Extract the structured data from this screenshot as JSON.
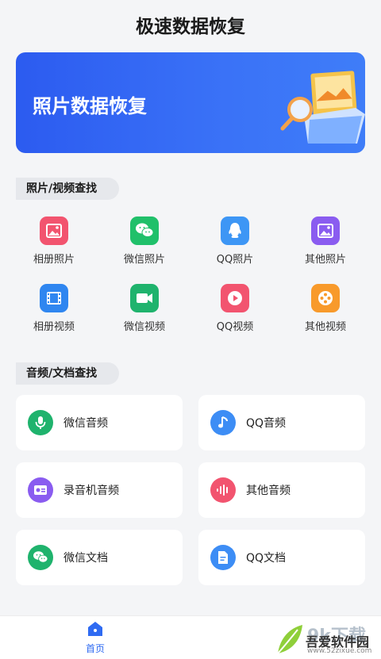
{
  "header": {
    "title": "极速数据恢复"
  },
  "banner": {
    "label": "照片数据恢复"
  },
  "sections": {
    "photo_video": "照片/视频查找",
    "audio_doc": "音频/文档查找"
  },
  "grid": [
    {
      "label": "相册照片",
      "color": "#f2546f",
      "icon": "image-icon"
    },
    {
      "label": "微信照片",
      "color": "#20c06a",
      "icon": "wechat-icon"
    },
    {
      "label": "QQ照片",
      "color": "#3d96f5",
      "icon": "qq-icon"
    },
    {
      "label": "其他照片",
      "color": "#8a5cf0",
      "icon": "image-icon"
    },
    {
      "label": "相册视频",
      "color": "#2f86f0",
      "icon": "film-icon"
    },
    {
      "label": "微信视频",
      "color": "#1fb36d",
      "icon": "video-camera-icon"
    },
    {
      "label": "QQ视频",
      "color": "#f2546f",
      "icon": "play-icon"
    },
    {
      "label": "其他视频",
      "color": "#f89a2b",
      "icon": "film-reel-icon"
    }
  ],
  "cards": [
    {
      "label": "微信音频",
      "color": "#1fb36d",
      "icon": "microphone-icon"
    },
    {
      "label": "QQ音频",
      "color": "#3d8df5",
      "icon": "music-note-icon"
    },
    {
      "label": "录音机音频",
      "color": "#8a5cf0",
      "icon": "recorder-icon"
    },
    {
      "label": "其他音频",
      "color": "#f2546f",
      "icon": "audio-wave-icon"
    },
    {
      "label": "微信文档",
      "color": "#1fb36d",
      "icon": "wechat-icon"
    },
    {
      "label": "QQ文档",
      "color": "#3d8df5",
      "icon": "document-icon"
    }
  ],
  "tabbar": {
    "home_label": "首页",
    "active_color": "#2f6bf2"
  },
  "watermark": {
    "name": "吾爱软件园",
    "url": "www.52zixue.com",
    "big": "9k下载"
  }
}
